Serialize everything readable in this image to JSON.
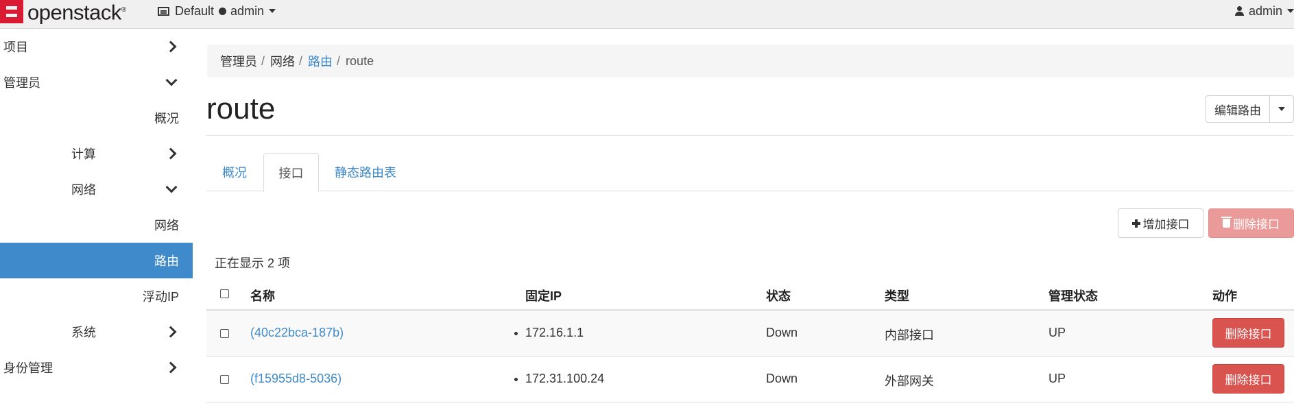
{
  "topbar": {
    "brand": "openstack",
    "brand_mark": "®",
    "domain": "Default",
    "project": "admin",
    "user": "admin"
  },
  "sidebar": {
    "items": [
      {
        "label": "项目",
        "chevron": "right",
        "active": false
      },
      {
        "label": "管理员",
        "chevron": "down",
        "active": false
      },
      {
        "label": "概况",
        "chevron": "",
        "active": false
      },
      {
        "label": "计算",
        "chevron": "right",
        "active": false
      },
      {
        "label": "网络",
        "chevron": "down",
        "active": false
      },
      {
        "label": "网络",
        "chevron": "",
        "active": false
      },
      {
        "label": "路由",
        "chevron": "",
        "active": true
      },
      {
        "label": "浮动IP",
        "chevron": "",
        "active": false
      },
      {
        "label": "系统",
        "chevron": "right",
        "active": false
      },
      {
        "label": "身份管理",
        "chevron": "right",
        "active": false
      }
    ]
  },
  "breadcrumb": {
    "items": [
      "管理员",
      "网络",
      "路由",
      "route"
    ],
    "separator": "/"
  },
  "page": {
    "title": "route",
    "edit_button": "编辑路由"
  },
  "tabs": [
    {
      "label": "概况",
      "active": false
    },
    {
      "label": "接口",
      "active": true
    },
    {
      "label": "静态路由表",
      "active": false
    }
  ],
  "actions": {
    "add_interface": "增加接口",
    "delete_interfaces": "删除接口"
  },
  "table": {
    "count_text": "正在显示 2 项",
    "columns": [
      "名称",
      "固定IP",
      "状态",
      "类型",
      "管理状态",
      "动作"
    ],
    "rows": [
      {
        "name": "(40c22bca-187b)",
        "fixed_ip": "172.16.1.1",
        "status": "Down",
        "type": "内部接口",
        "admin_state": "UP",
        "action": "删除接口"
      },
      {
        "name": "(f15955d8-5036)",
        "fixed_ip": "172.31.100.24",
        "status": "Down",
        "type": "外部网关",
        "admin_state": "UP",
        "action": "删除接口"
      }
    ]
  },
  "colors": {
    "accent": "#3f8acb",
    "danger": "#d9534f",
    "danger_disabled": "#ea9a98",
    "brand_red": "#da1a32"
  }
}
